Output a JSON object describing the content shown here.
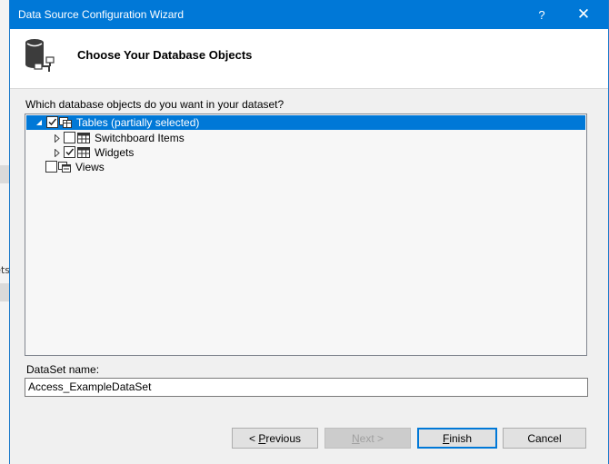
{
  "window": {
    "title": "Data Source Configuration Wizard",
    "help_glyph": "?",
    "close_glyph": "✕"
  },
  "background": {
    "clipped_text": "ets"
  },
  "header": {
    "title": "Choose Your Database Objects"
  },
  "prompt": "Which database objects do you want in your dataset?",
  "tree": {
    "tables": {
      "label": "Tables (partially selected)",
      "checked": "partial",
      "expanded": true
    },
    "children": [
      {
        "label": "Switchboard Items",
        "checked": false
      },
      {
        "label": "Widgets",
        "checked": true
      }
    ],
    "views": {
      "label": "Views",
      "checked": false
    }
  },
  "dataset": {
    "label": "DataSet name:",
    "value": "Access_ExampleDataSet"
  },
  "buttons": {
    "previous": {
      "prefix": "< ",
      "mnemonic": "P",
      "rest": "revious"
    },
    "next": {
      "mnemonic": "N",
      "rest": "ext >"
    },
    "finish": {
      "mnemonic": "F",
      "rest": "inish"
    },
    "cancel": "Cancel"
  },
  "colors": {
    "titlebar": "#0078d7",
    "selection": "#0078d7"
  }
}
